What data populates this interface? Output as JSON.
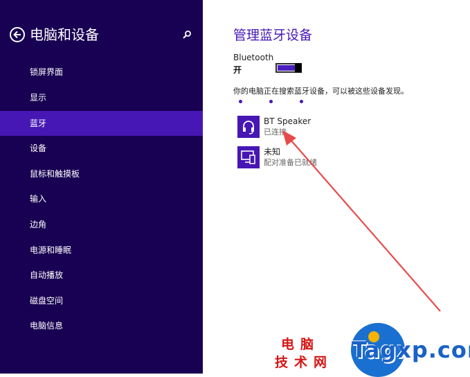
{
  "sidebar": {
    "title": "电脑和设备",
    "items": [
      {
        "label": "锁屏界面"
      },
      {
        "label": "显示"
      },
      {
        "label": "蓝牙"
      },
      {
        "label": "设备"
      },
      {
        "label": "鼠标和触摸板"
      },
      {
        "label": "输入"
      },
      {
        "label": "边角"
      },
      {
        "label": "电源和睡眠"
      },
      {
        "label": "自动播放"
      },
      {
        "label": "磁盘空间"
      },
      {
        "label": "电脑信息"
      }
    ],
    "active_index": 2
  },
  "main": {
    "title": "管理蓝牙设备",
    "bluetooth_label": "Bluetooth",
    "bluetooth_state": "开",
    "bluetooth_on": true,
    "searching_text": "你的电脑正在搜索蓝牙设备，可以被这些设备发现。",
    "devices": [
      {
        "name": "BT Speaker",
        "status": "已连接",
        "icon": "headset-icon"
      },
      {
        "name": "未知",
        "status": "配对准备已就绪",
        "icon": "device-icon"
      }
    ]
  },
  "watermark": {
    "line1": "电脑",
    "line2": "技术网",
    "logo": "Tagxp.com"
  },
  "colors": {
    "sidebar_bg": "#180052",
    "accent": "#4617b4",
    "arrow": "#e84a4a"
  }
}
